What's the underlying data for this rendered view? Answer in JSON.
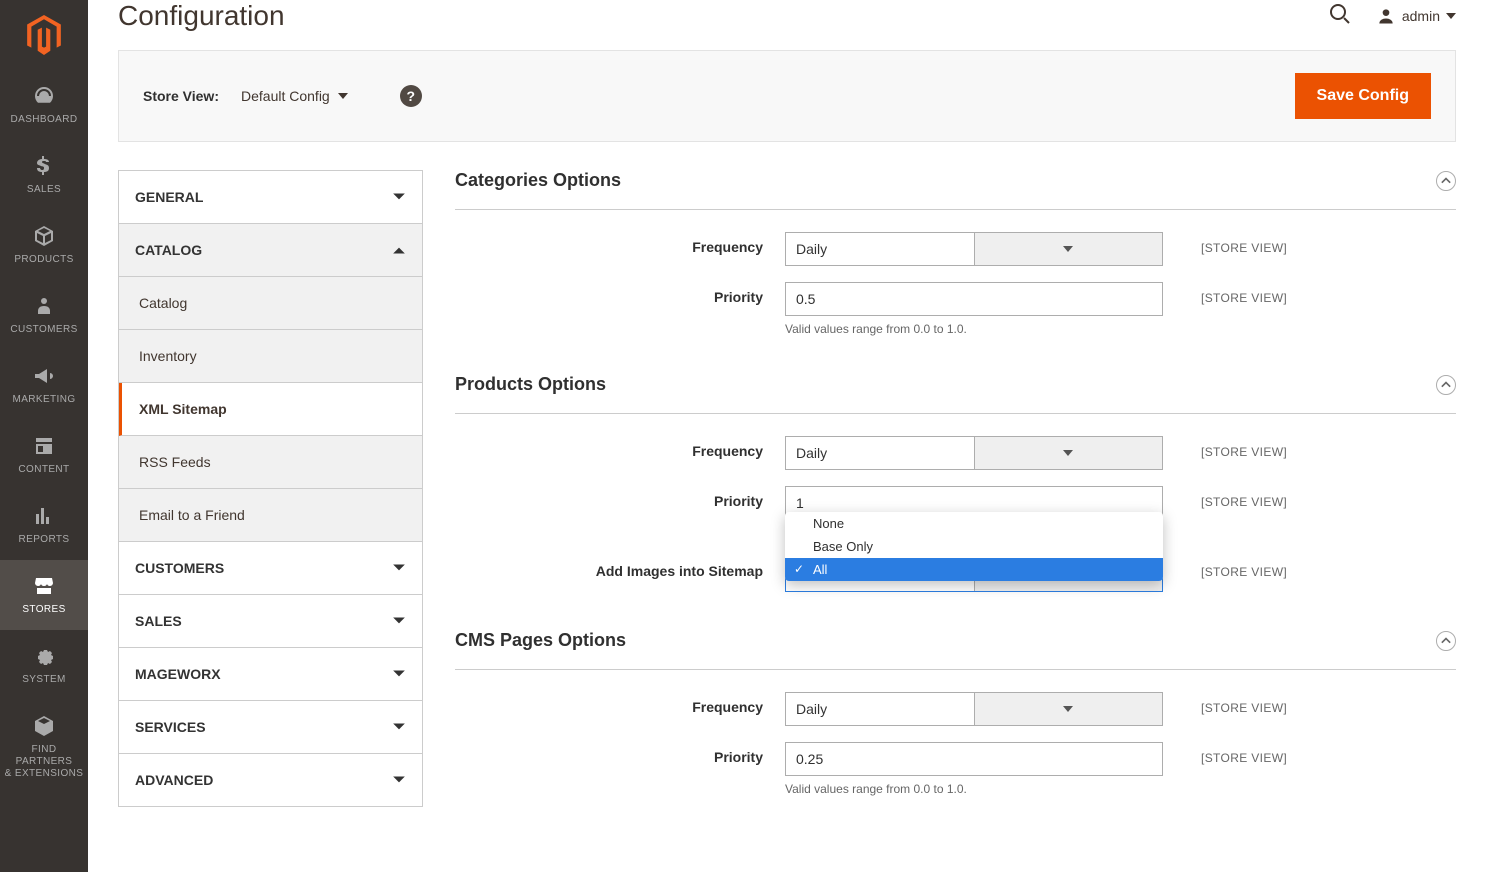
{
  "nav": {
    "items": [
      {
        "label": "DASHBOARD"
      },
      {
        "label": "SALES"
      },
      {
        "label": "PRODUCTS"
      },
      {
        "label": "CUSTOMERS"
      },
      {
        "label": "MARKETING"
      },
      {
        "label": "CONTENT"
      },
      {
        "label": "REPORTS"
      },
      {
        "label": "STORES"
      },
      {
        "label": "SYSTEM"
      },
      {
        "label": "FIND PARTNERS\n& EXTENSIONS"
      }
    ]
  },
  "header": {
    "title": "Configuration",
    "admin_label": "admin"
  },
  "toolbar": {
    "scope_label": "Store View:",
    "scope_value": "Default Config",
    "save_label": "Save Config"
  },
  "tabs": {
    "groups": [
      {
        "label": "GENERAL"
      },
      {
        "label": "CATALOG",
        "open": true,
        "items": [
          {
            "label": "Catalog"
          },
          {
            "label": "Inventory"
          },
          {
            "label": "XML Sitemap",
            "active": true
          },
          {
            "label": "RSS Feeds"
          },
          {
            "label": "Email to a Friend"
          }
        ]
      },
      {
        "label": "CUSTOMERS"
      },
      {
        "label": "SALES"
      },
      {
        "label": "MAGEWORX"
      },
      {
        "label": "SERVICES"
      },
      {
        "label": "ADVANCED"
      }
    ]
  },
  "panels": {
    "scope_tag": "[STORE VIEW]",
    "priority_hint": "Valid values range from 0.0 to 1.0.",
    "categories": {
      "title": "Categories Options",
      "freq_label": "Frequency",
      "freq_value": "Daily",
      "prio_label": "Priority",
      "prio_value": "0.5"
    },
    "products": {
      "title": "Products Options",
      "freq_label": "Frequency",
      "freq_value": "Daily",
      "prio_label": "Priority",
      "prio_value": "1",
      "img_label": "Add Images into Sitemap",
      "img_options": [
        "None",
        "Base Only",
        "All"
      ],
      "img_selected": "All"
    },
    "cms": {
      "title": "CMS Pages Options",
      "freq_label": "Frequency",
      "freq_value": "Daily",
      "prio_label": "Priority",
      "prio_value": "0.25"
    }
  }
}
